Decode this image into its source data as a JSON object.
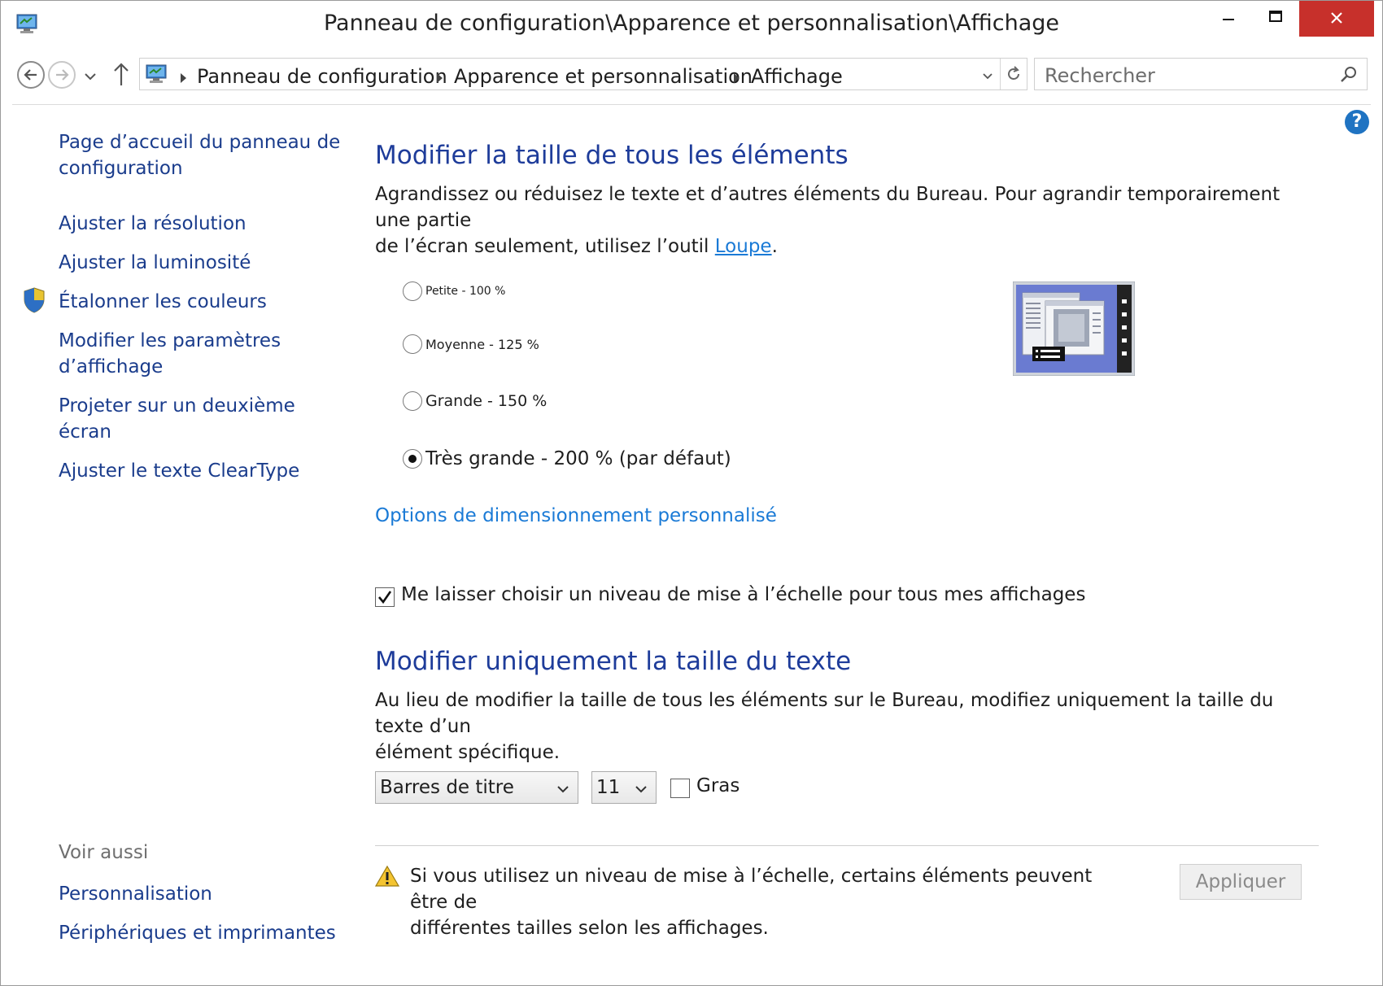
{
  "window": {
    "title": "Panneau de configuration\\Apparence et personnalisation\\Affichage",
    "close_color": "#c7302b"
  },
  "address": {
    "crumbs": [
      "Panneau de configuration",
      "Apparence et personnalisation",
      "Affichage"
    ],
    "search_placeholder": "Rechercher"
  },
  "help": {
    "label": "?"
  },
  "sidebar": {
    "items": [
      {
        "label_line1": "Page d’accueil du panneau de",
        "label_line2": "configuration"
      },
      {
        "label": "Ajuster la résolution"
      },
      {
        "label": "Ajuster la luminosité"
      },
      {
        "label": "Étalonner les couleurs"
      },
      {
        "label_line1": "Modifier les paramètres",
        "label_line2": "d’affichage"
      },
      {
        "label_line1": "Projeter sur un deuxième",
        "label_line2": "écran"
      },
      {
        "label": "Ajuster le texte ClearType"
      }
    ],
    "see_also": {
      "heading": "Voir aussi",
      "items": [
        "Personnalisation",
        "Périphériques et imprimantes"
      ]
    }
  },
  "main": {
    "section1": {
      "title": "Modifier la taille de tous les éléments",
      "desc_line1": "Agrandissez ou réduisez le texte et d’autres éléments du Bureau. Pour agrandir temporairement une partie",
      "desc_line2_before": "de l’écran seulement, utilisez l’outil ",
      "desc_link": "Loupe",
      "desc_line2_after": "."
    },
    "options": [
      {
        "label": "Petite - 100 %",
        "checked": false
      },
      {
        "label": "Moyenne - 125 %",
        "checked": false
      },
      {
        "label": "Grande - 150 %",
        "checked": false
      },
      {
        "label": "Très grande - 200 % (par défaut)",
        "checked": true
      }
    ],
    "custom_link": "Options de dimensionnement personnalisé",
    "scale_checkbox": {
      "label": "Me laisser choisir un niveau de mise à l’échelle pour tous mes affichages",
      "checked": true
    },
    "section2": {
      "title": "Modifier uniquement la taille du texte",
      "desc_line1": "Au lieu de modifier la taille de tous les éléments sur le Bureau, modifiez uniquement la taille du texte d’un",
      "desc_line2": "élément spécifique."
    },
    "element_select": {
      "value": "Barres de titre"
    },
    "size_select": {
      "value": "11"
    },
    "bold_checkbox": {
      "label": "Gras",
      "checked": false
    },
    "warning": {
      "line1": "Si vous utilisez un niveau de mise à l’échelle, certains éléments peuvent être de",
      "line2": "différentes tailles selon les affichages."
    },
    "apply_button": "Appliquer"
  }
}
